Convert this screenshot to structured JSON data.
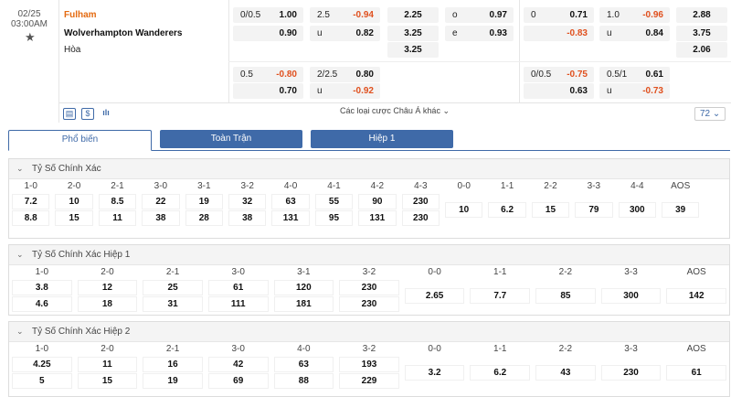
{
  "match": {
    "date": "02/25",
    "time": "03:00AM",
    "home": "Fulham",
    "away": "Wolverhampton Wanderers",
    "draw": "Hòa"
  },
  "odds": {
    "row1": {
      "ah_line": "0/0.5",
      "ah_home": "1.00",
      "ah_away": "0.90",
      "ou_line": "2.5",
      "ou_over": "-0.94",
      "ou_u": "u",
      "ou_under": "0.82",
      "x12_1": "2.25",
      "x12_2": "3.25",
      "x12_3": "3.25",
      "oe_o": "o",
      "oe_ov": "0.97",
      "oe_e": "e",
      "oe_ev": "0.93",
      "h1_ah_line": "0",
      "h1_ah_home": "0.71",
      "h1_ah_away": "-0.83",
      "h1_ou_line": "1.0",
      "h1_ou_over": "-0.96",
      "h1_ou_u": "u",
      "h1_ou_under": "0.84",
      "h1_x12_1": "2.88",
      "h1_x12_2": "3.75",
      "h1_x12_3": "2.06"
    },
    "row2": {
      "ah_line": "0.5",
      "ah_home": "-0.80",
      "ah_away": "0.70",
      "ou_line": "2/2.5",
      "ou_over": "0.80",
      "ou_u": "u",
      "ou_under": "-0.92",
      "h1_ah_line": "0/0.5",
      "h1_ah_home": "-0.75",
      "h1_ah_away": "0.63",
      "h1_ou_line": "0.5/1",
      "h1_ou_over": "0.61",
      "h1_ou_u": "u",
      "h1_ou_under": "-0.73"
    }
  },
  "toolbar": {
    "icon1": "calendar-icon",
    "icon2": "dollar-icon",
    "icon3": "chart-icon",
    "more": "Các loại cược Châu Á khác",
    "chev": "⌄",
    "count": "72",
    "count_chev": "⌄"
  },
  "tabs": {
    "popular": "Phổ biến",
    "full": "Toàn Trận",
    "half1": "Hiệp 1"
  },
  "sections": [
    {
      "title": "Tỷ Số Chính Xác",
      "labels": [
        "1-0",
        "2-0",
        "2-1",
        "3-0",
        "3-1",
        "3-2",
        "4-0",
        "4-1",
        "4-2",
        "4-3",
        "0-0",
        "1-1",
        "2-2",
        "3-3",
        "4-4",
        "AOS"
      ],
      "home": [
        "7.2",
        "10",
        "8.5",
        "22",
        "19",
        "32",
        "63",
        "55",
        "90",
        "230"
      ],
      "away": [
        "8.8",
        "15",
        "11",
        "38",
        "28",
        "38",
        "131",
        "95",
        "131",
        "230"
      ],
      "draws": [
        "10",
        "6.2",
        "15",
        "79",
        "300",
        "39"
      ]
    },
    {
      "title": "Tỷ Số Chính Xác Hiệp 1",
      "labels": [
        "1-0",
        "2-0",
        "2-1",
        "3-0",
        "3-1",
        "3-2",
        "0-0",
        "1-1",
        "2-2",
        "3-3",
        "AOS"
      ],
      "home": [
        "3.8",
        "12",
        "25",
        "61",
        "120",
        "230"
      ],
      "away": [
        "4.6",
        "18",
        "31",
        "111",
        "181",
        "230"
      ],
      "draws": [
        "2.65",
        "7.7",
        "85",
        "300",
        "142"
      ]
    },
    {
      "title": "Tỷ Số Chính Xác Hiệp 2",
      "labels": [
        "1-0",
        "2-0",
        "2-1",
        "3-0",
        "4-0",
        "3-2",
        "0-0",
        "1-1",
        "2-2",
        "3-3",
        "AOS"
      ],
      "home": [
        "4.25",
        "11",
        "16",
        "42",
        "63",
        "193"
      ],
      "away": [
        "5",
        "15",
        "19",
        "69",
        "88",
        "229"
      ],
      "draws": [
        "3.2",
        "6.2",
        "43",
        "230",
        "61"
      ]
    }
  ],
  "colors": {
    "accent": "#3f6aa8",
    "home_team": "#e46a10",
    "negative": "#e0501e"
  }
}
